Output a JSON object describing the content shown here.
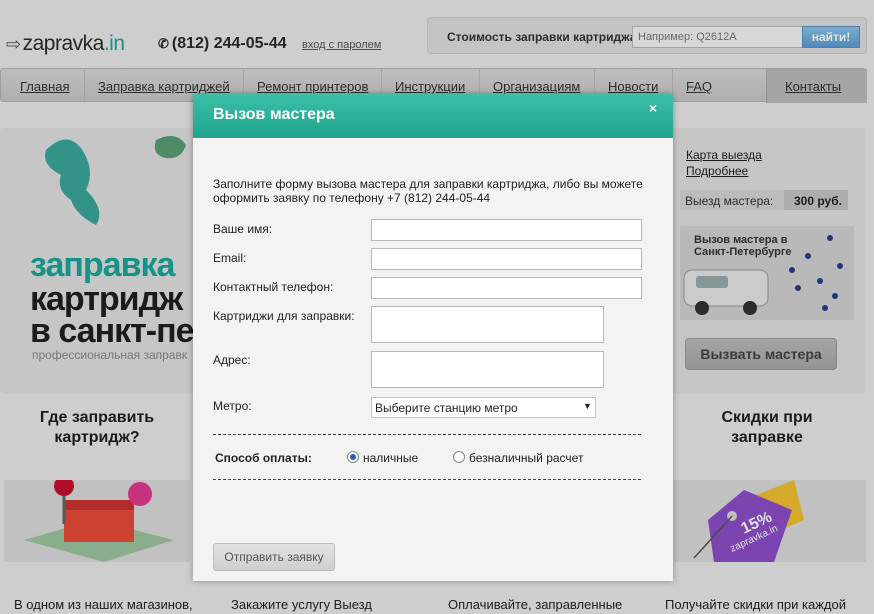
{
  "header": {
    "logo_main": "zapravka",
    "logo_tld": ".in",
    "phone": "(812) 244-05-44",
    "login_link": "вход с паролем",
    "price_check": {
      "label": "Стоимость заправки картриджа:",
      "placeholder": "Например: Q2612A",
      "button": "найти!"
    }
  },
  "nav": {
    "items": [
      {
        "label": "Главная"
      },
      {
        "label": "Заправка картриджей"
      },
      {
        "label": "Ремонт принтеров"
      },
      {
        "label": "Инструкции"
      },
      {
        "label": "Организациям"
      },
      {
        "label": "Новости"
      },
      {
        "label": "FAQ"
      },
      {
        "label": "Контакты"
      }
    ]
  },
  "banner": {
    "line1": "заправка",
    "line2": "картридж",
    "line3": "в санкт-пе",
    "subtitle": "профессиональная заправк"
  },
  "sidebar": {
    "map_link": "Карта выезда",
    "more_link": "Подробнее",
    "trip_label": "Выезд мастера:",
    "trip_price": "300 руб.",
    "map_title": "Вызов мастера в Санкт-Петербурге",
    "call_button": "Вызвать мастера"
  },
  "columns": {
    "left_title": "Где заправить картридж?",
    "right_title": "Скидки при заправке",
    "texts": [
      "В одном из наших магазинов,",
      "Закажите услугу Выезд",
      "Оплачивайте, заправленные",
      "Получайте скидки при каждой"
    ],
    "tag_discount": "15%",
    "tag_brand": "zapravka.in"
  },
  "modal": {
    "title": "Вызов мастера",
    "close": "×",
    "intro": "Заполните форму вызова мастера для заправки картриджа, либо вы можете оформить заявку по телефону +7 (812) 244-05-44",
    "fields": {
      "name": "Ваше имя:",
      "email": "Email:",
      "phone": "Контактный телефон:",
      "cartridges": "Картриджи для заправки:",
      "address": "Адрес:",
      "metro": "Метро:"
    },
    "metro_selected": "Выберите станцию метро",
    "payment": {
      "label": "Способ оплаты:",
      "option_cash": "наличные",
      "option_cashless": "безналичный расчет"
    },
    "submit": "Отправить заявку"
  },
  "colors": {
    "accent": "#1fa38d",
    "brand_teal": "#1aa89c",
    "search_button": "#5b9ed6"
  }
}
